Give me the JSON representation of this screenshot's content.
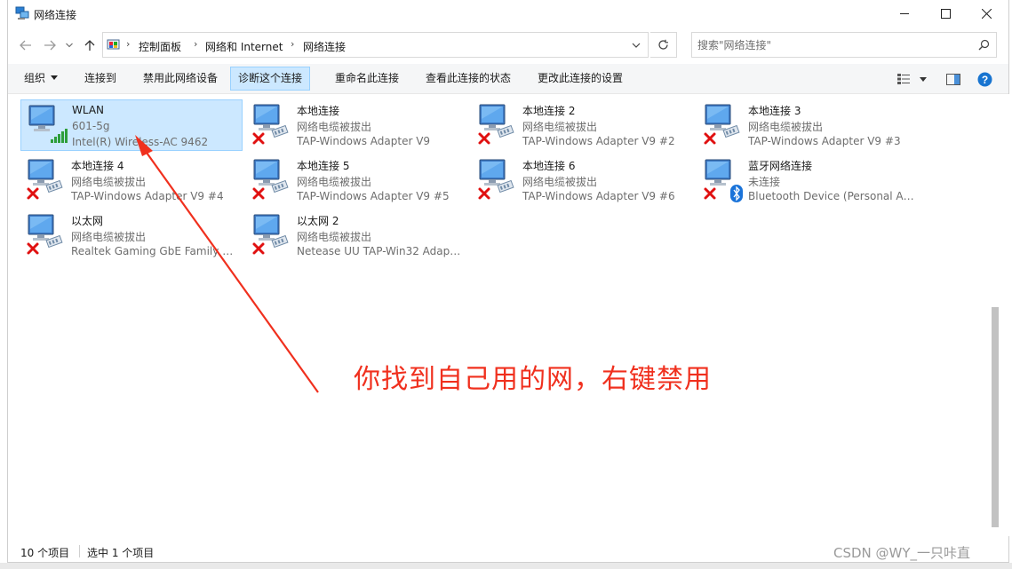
{
  "window": {
    "title": "网络连接",
    "controls": {
      "minimize": "minimize-icon",
      "maximize": "maximize-icon",
      "close": "close-icon"
    }
  },
  "address": {
    "breadcrumbs": [
      "控制面板",
      "网络和 Internet",
      "网络连接"
    ],
    "search_placeholder": "搜索\"网络连接\""
  },
  "commands": [
    {
      "label": "组织",
      "has_dropdown": true
    },
    {
      "label": "连接到"
    },
    {
      "label": "禁用此网络设备"
    },
    {
      "label": "诊断这个连接",
      "active": true
    },
    {
      "label": "重命名此连接"
    },
    {
      "label": "查看此连接的状态"
    },
    {
      "label": "更改此连接的设置"
    }
  ],
  "connections": [
    {
      "name": "WLAN",
      "status": "601-5g",
      "device": "Intel(R) Wireless-AC 9462",
      "kind": "wifi",
      "selected": true
    },
    {
      "name": "本地连接",
      "status": "网络电缆被拔出",
      "device": "TAP-Windows Adapter V9",
      "kind": "cable-unplugged"
    },
    {
      "name": "本地连接 2",
      "status": "网络电缆被拔出",
      "device": "TAP-Windows Adapter V9 #2",
      "kind": "cable-unplugged"
    },
    {
      "name": "本地连接 3",
      "status": "网络电缆被拔出",
      "device": "TAP-Windows Adapter V9 #3",
      "kind": "cable-unplugged"
    },
    {
      "name": "本地连接 4",
      "status": "网络电缆被拔出",
      "device": "TAP-Windows Adapter V9 #4",
      "kind": "cable-unplugged"
    },
    {
      "name": "本地连接 5",
      "status": "网络电缆被拔出",
      "device": "TAP-Windows Adapter V9 #5",
      "kind": "cable-unplugged"
    },
    {
      "name": "本地连接 6",
      "status": "网络电缆被拔出",
      "device": "TAP-Windows Adapter V9 #6",
      "kind": "cable-unplugged"
    },
    {
      "name": "蓝牙网络连接",
      "status": "未连接",
      "device": "Bluetooth Device (Personal Ar...",
      "kind": "bluetooth"
    },
    {
      "name": "以太网",
      "status": "网络电缆被拔出",
      "device": "Realtek Gaming GbE Family C...",
      "kind": "cable-unplugged"
    },
    {
      "name": "以太网 2",
      "status": "网络电缆被拔出",
      "device": "Netease UU TAP-Win32 Adapt...",
      "kind": "cable-unplugged"
    }
  ],
  "statusbar": {
    "item_count": "10 个项目",
    "selected_count": "选中 1 个项目"
  },
  "annotation": {
    "text": "你找到自己用的网，右键禁用",
    "color": "#f0301e"
  },
  "watermark": "CSDN @WY_一只咔直"
}
